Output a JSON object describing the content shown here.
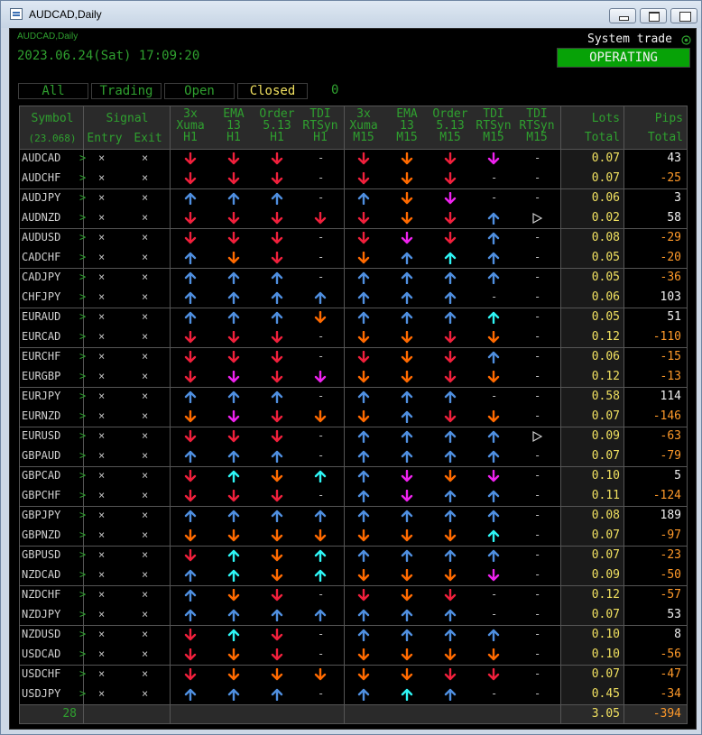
{
  "window": {
    "title": "AUDCAD,Daily"
  },
  "chart": {
    "label": "AUDCAD,Daily",
    "datetime": "2023.06.24(Sat) 17:09:20"
  },
  "system": {
    "label": "System trade",
    "status": "OPERATING"
  },
  "filters": {
    "tabs": [
      "All",
      "Trading",
      "Open",
      "Closed"
    ],
    "count": "0",
    "active": "Closed"
  },
  "headers": {
    "symbol": "Symbol",
    "symbol_count": "(23.068)",
    "signal": "Signal",
    "entry": "Entry",
    "exit": "Exit",
    "h1": [
      [
        "3x",
        "Xuma",
        "H1"
      ],
      [
        "EMA",
        "13",
        "H1"
      ],
      [
        "Order",
        "5.13",
        "H1"
      ],
      [
        "TDI",
        "RTSyn",
        "H1"
      ]
    ],
    "m15": [
      [
        "3x",
        "Xuma",
        "M15"
      ],
      [
        "EMA",
        "13",
        "M15"
      ],
      [
        "Order",
        "5.13",
        "M15"
      ],
      [
        "TDI",
        "RTSyn",
        "M15"
      ],
      [
        "TDI",
        "RTSyn",
        "M15"
      ]
    ],
    "lots": [
      "Lots",
      "Total"
    ],
    "pips": [
      "Pips",
      "Total"
    ]
  },
  "rows": [
    {
      "symbol": "AUDCAD",
      "entry": "×",
      "exit": "×",
      "signals": [
        "d:r",
        "d:r",
        "d:r",
        "-",
        "d:r",
        "d:o",
        "d:r",
        "d:m",
        "-"
      ],
      "lots": "0.07",
      "pips": "43"
    },
    {
      "symbol": "AUDCHF",
      "entry": "×",
      "exit": "×",
      "signals": [
        "d:r",
        "d:r",
        "d:r",
        "-",
        "d:r",
        "d:o",
        "d:r",
        "-",
        "-"
      ],
      "lots": "0.07",
      "pips": "-25"
    },
    {
      "symbol": "AUDJPY",
      "entry": "×",
      "exit": "×",
      "signals": [
        "u:b",
        "u:b",
        "u:b",
        "-",
        "u:b",
        "d:o",
        "d:m",
        "-",
        "-"
      ],
      "lots": "0.06",
      "pips": "3"
    },
    {
      "symbol": "AUDNZD",
      "entry": "×",
      "exit": "×",
      "signals": [
        "d:r",
        "d:r",
        "d:r",
        "d:r",
        "d:r",
        "d:o",
        "d:r",
        "u:b",
        "t:w"
      ],
      "lots": "0.02",
      "pips": "58"
    },
    {
      "symbol": "AUDUSD",
      "entry": "×",
      "exit": "×",
      "signals": [
        "d:r",
        "d:r",
        "d:r",
        "-",
        "d:r",
        "d:m",
        "d:r",
        "u:b",
        "-"
      ],
      "lots": "0.08",
      "pips": "-29"
    },
    {
      "symbol": "CADCHF",
      "entry": "×",
      "exit": "×",
      "signals": [
        "u:b",
        "d:o",
        "d:r",
        "-",
        "d:o",
        "u:b",
        "u:c",
        "u:b",
        "-"
      ],
      "lots": "0.05",
      "pips": "-20"
    },
    {
      "symbol": "CADJPY",
      "entry": "×",
      "exit": "×",
      "signals": [
        "u:b",
        "u:b",
        "u:b",
        "-",
        "u:b",
        "u:b",
        "u:b",
        "u:b",
        "-"
      ],
      "lots": "0.05",
      "pips": "-36"
    },
    {
      "symbol": "CHFJPY",
      "entry": "×",
      "exit": "×",
      "signals": [
        "u:b",
        "u:b",
        "u:b",
        "u:b",
        "u:b",
        "u:b",
        "u:b",
        "-",
        "-"
      ],
      "lots": "0.06",
      "pips": "103"
    },
    {
      "symbol": "EURAUD",
      "entry": "×",
      "exit": "×",
      "signals": [
        "u:b",
        "u:b",
        "u:b",
        "d:o",
        "u:b",
        "u:b",
        "u:b",
        "u:c",
        "-"
      ],
      "lots": "0.05",
      "pips": "51"
    },
    {
      "symbol": "EURCAD",
      "entry": "×",
      "exit": "×",
      "signals": [
        "d:r",
        "d:r",
        "d:r",
        "-",
        "d:o",
        "d:o",
        "d:r",
        "d:o",
        "-"
      ],
      "lots": "0.12",
      "pips": "-110"
    },
    {
      "symbol": "EURCHF",
      "entry": "×",
      "exit": "×",
      "signals": [
        "d:r",
        "d:r",
        "d:r",
        "-",
        "d:r",
        "d:o",
        "d:r",
        "u:b",
        "-"
      ],
      "lots": "0.06",
      "pips": "-15"
    },
    {
      "symbol": "EURGBP",
      "entry": "×",
      "exit": "×",
      "signals": [
        "d:r",
        "d:m",
        "d:r",
        "d:m",
        "d:o",
        "d:o",
        "d:r",
        "d:o",
        "-"
      ],
      "lots": "0.12",
      "pips": "-13"
    },
    {
      "symbol": "EURJPY",
      "entry": "×",
      "exit": "×",
      "signals": [
        "u:b",
        "u:b",
        "u:b",
        "-",
        "u:b",
        "u:b",
        "u:b",
        "-",
        "-"
      ],
      "lots": "0.58",
      "pips": "114"
    },
    {
      "symbol": "EURNZD",
      "entry": "×",
      "exit": "×",
      "signals": [
        "d:o",
        "d:m",
        "d:r",
        "d:o",
        "d:o",
        "u:b",
        "d:r",
        "d:o",
        "-"
      ],
      "lots": "0.07",
      "pips": "-146"
    },
    {
      "symbol": "EURUSD",
      "entry": "×",
      "exit": "×",
      "signals": [
        "d:r",
        "d:r",
        "d:r",
        "-",
        "u:b",
        "u:b",
        "u:b",
        "u:b",
        "t:w"
      ],
      "lots": "0.09",
      "pips": "-63"
    },
    {
      "symbol": "GBPAUD",
      "entry": "×",
      "exit": "×",
      "signals": [
        "u:b",
        "u:b",
        "u:b",
        "-",
        "u:b",
        "u:b",
        "u:b",
        "u:b",
        "-"
      ],
      "lots": "0.07",
      "pips": "-79"
    },
    {
      "symbol": "GBPCAD",
      "entry": "×",
      "exit": "×",
      "signals": [
        "d:r",
        "u:c",
        "d:o",
        "u:c",
        "u:b",
        "d:m",
        "d:o",
        "d:m",
        "-"
      ],
      "lots": "0.10",
      "pips": "5"
    },
    {
      "symbol": "GBPCHF",
      "entry": "×",
      "exit": "×",
      "signals": [
        "d:r",
        "d:r",
        "d:r",
        "-",
        "u:b",
        "d:m",
        "u:b",
        "u:b",
        "-"
      ],
      "lots": "0.11",
      "pips": "-124"
    },
    {
      "symbol": "GBPJPY",
      "entry": "×",
      "exit": "×",
      "signals": [
        "u:b",
        "u:b",
        "u:b",
        "u:b",
        "u:b",
        "u:b",
        "u:b",
        "u:b",
        "-"
      ],
      "lots": "0.08",
      "pips": "189"
    },
    {
      "symbol": "GBPNZD",
      "entry": "×",
      "exit": "×",
      "signals": [
        "d:o",
        "d:o",
        "d:o",
        "d:o",
        "d:o",
        "d:o",
        "d:o",
        "u:c",
        "-"
      ],
      "lots": "0.07",
      "pips": "-97"
    },
    {
      "symbol": "GBPUSD",
      "entry": "×",
      "exit": "×",
      "signals": [
        "d:r",
        "u:c",
        "d:o",
        "u:c",
        "u:b",
        "u:b",
        "u:b",
        "u:b",
        "-"
      ],
      "lots": "0.07",
      "pips": "-23"
    },
    {
      "symbol": "NZDCAD",
      "entry": "×",
      "exit": "×",
      "signals": [
        "u:b",
        "u:c",
        "d:o",
        "u:c",
        "d:o",
        "d:o",
        "d:o",
        "d:m",
        "-"
      ],
      "lots": "0.09",
      "pips": "-50"
    },
    {
      "symbol": "NZDCHF",
      "entry": "×",
      "exit": "×",
      "signals": [
        "u:b",
        "d:o",
        "d:r",
        "-",
        "d:r",
        "d:o",
        "d:r",
        "-",
        "-"
      ],
      "lots": "0.12",
      "pips": "-57"
    },
    {
      "symbol": "NZDJPY",
      "entry": "×",
      "exit": "×",
      "signals": [
        "u:b",
        "u:b",
        "u:b",
        "u:b",
        "u:b",
        "u:b",
        "u:b",
        "-",
        "-"
      ],
      "lots": "0.07",
      "pips": "53"
    },
    {
      "symbol": "NZDUSD",
      "entry": "×",
      "exit": "×",
      "signals": [
        "d:r",
        "u:c",
        "d:r",
        "-",
        "u:b",
        "u:b",
        "u:b",
        "u:b",
        "-"
      ],
      "lots": "0.10",
      "pips": "8"
    },
    {
      "symbol": "USDCAD",
      "entry": "×",
      "exit": "×",
      "signals": [
        "d:r",
        "d:o",
        "d:r",
        "-",
        "d:o",
        "d:o",
        "d:o",
        "d:o",
        "-"
      ],
      "lots": "0.10",
      "pips": "-56"
    },
    {
      "symbol": "USDCHF",
      "entry": "×",
      "exit": "×",
      "signals": [
        "d:r",
        "d:o",
        "d:o",
        "d:o",
        "d:o",
        "d:o",
        "d:r",
        "d:r",
        "-"
      ],
      "lots": "0.07",
      "pips": "-47"
    },
    {
      "symbol": "USDJPY",
      "entry": "×",
      "exit": "×",
      "signals": [
        "u:b",
        "u:b",
        "u:b",
        "-",
        "u:b",
        "u:c",
        "u:b",
        "-",
        "-"
      ],
      "lots": "0.45",
      "pips": "-34"
    }
  ],
  "footer": {
    "count": "28",
    "lots_total": "3.05",
    "pips_total": "-394"
  },
  "colors": {
    "r": "#f0203c",
    "o": "#ff6a00",
    "m": "#ee22ee",
    "b": "#4f8fe0",
    "c": "#2ef5f5",
    "w": "#cfcfcf",
    "green": "#2fa02f",
    "yellow": "#f0e060",
    "white": "#f0f0f0",
    "orange": "#ff9a2a",
    "status_bg": "#07a207"
  },
  "icons": {
    "u": "arrow-up-icon",
    "d": "arrow-down-icon",
    "t": "triangle-right-icon",
    "x": "cross-icon",
    "chev": "chevron-right-icon"
  }
}
